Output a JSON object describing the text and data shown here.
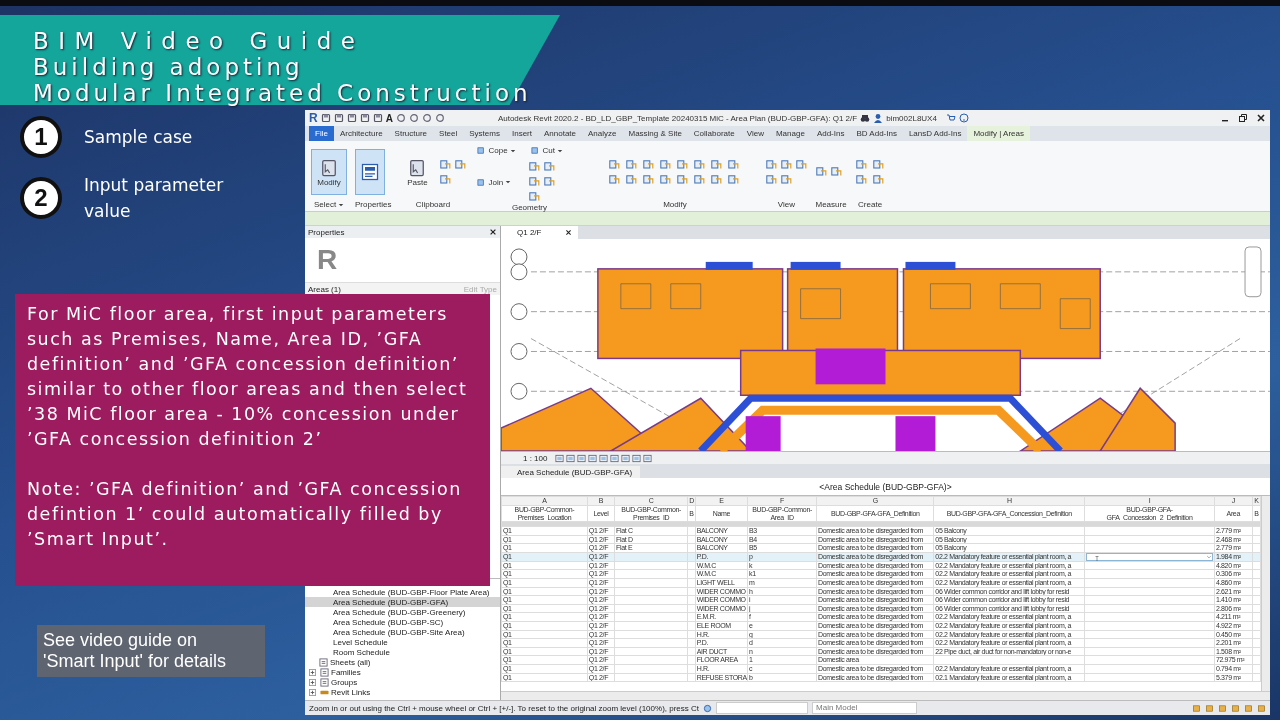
{
  "banner": {
    "lines": [
      "BIM Video Guide",
      "Building adopting",
      "Modular Integrated Construction"
    ]
  },
  "steps": [
    {
      "number": "1",
      "label": "Sample case"
    },
    {
      "number": "2",
      "label": "Input parameter value"
    }
  ],
  "note_box": {
    "paragraphs": [
      "For MiC floor area, first input parameters such as Premises, Name, Area ID, ’GFA definition’ and ’GFA concession definition’ similar to other floor areas and then select ’38 MiC floor area - 10% concession under ’GFA concession definition 2’",
      "Note: ’GFA definition’ and ’GFA concession defintion 1’ could automatically filled by ’Smart Input’."
    ]
  },
  "hint_box": {
    "text": "See video guide on 'Smart Input' for details"
  },
  "revit": {
    "app_logo": "R",
    "quick_access_glyph": "A",
    "title": "Autodesk Revit 2020.2 - BD_LD_GBP_Template 20240315 MiC - Area Plan (BUD-GBP-GFA): Q1 2/F",
    "user": "bim002L8UX4",
    "tabs": [
      {
        "label": "File",
        "kind": "file",
        "selected": false
      },
      {
        "label": "Architecture",
        "kind": "tab",
        "selected": false
      },
      {
        "label": "Structure",
        "kind": "tab",
        "selected": false
      },
      {
        "label": "Steel",
        "kind": "tab",
        "selected": false
      },
      {
        "label": "Systems",
        "kind": "tab",
        "selected": false
      },
      {
        "label": "Insert",
        "kind": "tab",
        "selected": false
      },
      {
        "label": "Annotate",
        "kind": "tab",
        "selected": false
      },
      {
        "label": "Analyze",
        "kind": "tab",
        "selected": false
      },
      {
        "label": "Massing & Site",
        "kind": "tab",
        "selected": false
      },
      {
        "label": "Collaborate",
        "kind": "tab",
        "selected": false
      },
      {
        "label": "View",
        "kind": "tab",
        "selected": false
      },
      {
        "label": "Manage",
        "kind": "tab",
        "selected": false
      },
      {
        "label": "Add-Ins",
        "kind": "tab",
        "selected": false
      },
      {
        "label": "BD Add-Ins",
        "kind": "tab",
        "selected": false
      },
      {
        "label": "LansD Add-Ins",
        "kind": "tab",
        "selected": false
      },
      {
        "label": "Modify | Areas",
        "kind": "tab",
        "selected": true
      }
    ],
    "ribbon_groups": [
      {
        "label": "Select",
        "menu": true,
        "tools": [
          {
            "kind": "large",
            "label": "Modify",
            "selected": true
          }
        ]
      },
      {
        "label": "Properties",
        "menu": false
      },
      {
        "label": "Clipboard",
        "menu": false,
        "tools": [
          {
            "kind": "large",
            "label": "Paste",
            "selected": false
          }
        ]
      },
      {
        "label": "Geometry",
        "menu": false,
        "tools": [
          {
            "kind": "small",
            "label": "Cope",
            "selected": false
          },
          {
            "kind": "small",
            "label": "Cut",
            "selected": false
          },
          {
            "kind": "small",
            "label": "Join",
            "selected": false
          }
        ]
      },
      {
        "label": "Modify",
        "menu": false
      },
      {
        "label": "View",
        "menu": false
      },
      {
        "label": "Measure",
        "menu": false
      },
      {
        "label": "Create",
        "menu": false
      }
    ],
    "properties": {
      "title": "Properties",
      "type_logo": "R",
      "category": "Areas (1)",
      "edit_type": "Edit Type"
    },
    "browser": {
      "items": [
        {
          "label": "Area Schedule (BUD-GBP-Floor Plate Area)",
          "kind": "view",
          "selected": false
        },
        {
          "label": "Area Schedule (BUD-GBP-GFA)",
          "kind": "view",
          "selected": true
        },
        {
          "label": "Area Schedule (BUD-GBP-Greenery)",
          "kind": "view",
          "selected": false
        },
        {
          "label": "Area Schedule (BUD-GBP-SC)",
          "kind": "view",
          "selected": false
        },
        {
          "label": "Area Schedule (BUD-GBP-Site Area)",
          "kind": "view",
          "selected": false
        },
        {
          "label": "Level Schedule",
          "kind": "view",
          "selected": false
        },
        {
          "label": "Room Schedule",
          "kind": "view",
          "selected": false
        },
        {
          "label": "Sheets (all)",
          "kind": "folder",
          "selected": false
        },
        {
          "label": "Families",
          "kind": "collapsed",
          "selected": false
        },
        {
          "label": "Groups",
          "kind": "collapsed",
          "selected": false
        },
        {
          "label": "Revit Links",
          "kind": "links",
          "selected": false
        }
      ]
    },
    "plan_view": {
      "tab": "Q1 2/F",
      "scale": "1 : 100"
    },
    "schedule": {
      "tab": "Area Schedule (BUD-GBP-GFA)",
      "title": "<Area Schedule (BUD-GBP-GFA)>",
      "letters": [
        "A",
        "B",
        "C",
        "D",
        "E",
        "F",
        "G",
        "H",
        "I",
        "J",
        "K"
      ],
      "headers": [
        "BUD-GBP-Common-Premises_Location",
        "Level",
        "BUD-GBP-Common-Premises_ID",
        "B",
        "Name",
        "BUD-GBP-Common-Area_ID",
        "BUD-GBP-GFA-GFA_Definition",
        "BUD-GBP-GFA-GFA_Concession_Definition",
        "BUD-GBP-GFA-GFA_Concession_2_Definition",
        "Area",
        "B"
      ],
      "rows": [
        {
          "location": "Q1",
          "level": "Q1 2/F",
          "premises_id": "Flat C",
          "name": "BALCONY",
          "area_id": "B3",
          "gfa_definition": "Domestic area to be disregarded from",
          "concession": "05 Balcony",
          "area": "2.779 m²",
          "selected": false,
          "editing": false
        },
        {
          "location": "Q1",
          "level": "Q1 2/F",
          "premises_id": "Flat D",
          "name": "BALCONY",
          "area_id": "B4",
          "gfa_definition": "Domestic area to be disregarded from",
          "concession": "05 Balcony",
          "area": "2.468 m²",
          "selected": false,
          "editing": false
        },
        {
          "location": "Q1",
          "level": "Q1 2/F",
          "premises_id": "Flat E",
          "name": "BALCONY",
          "area_id": "B5",
          "gfa_definition": "Domestic area to be disregarded from",
          "concession": "05 Balcony",
          "area": "2.779 m²",
          "selected": false,
          "editing": false
        },
        {
          "location": "Q1",
          "level": "Q1 2/F",
          "name": "P.D.",
          "area_id": "p",
          "gfa_definition": "Domestic area to be disregarded from",
          "concession": "02.2 Mandatory feature or essential plant room, a",
          "area": "1.984 m²",
          "selected": true,
          "editing": true
        },
        {
          "location": "Q1",
          "level": "Q1 2/F",
          "name": "W.M.C",
          "area_id": "k",
          "gfa_definition": "Domestic area to be disregarded from",
          "concession": "02.2 Mandatory feature or essential plant room, a",
          "area": "4.820 m²",
          "selected": false,
          "editing": false
        },
        {
          "location": "Q1",
          "level": "Q1 2/F",
          "name": "W.M.C",
          "area_id": "k1",
          "gfa_definition": "Domestic area to be disregarded from",
          "concession": "02.2 Mandatory feature or essential plant room, a",
          "area": "0.306 m²",
          "selected": false,
          "editing": false
        },
        {
          "location": "Q1",
          "level": "Q1 2/F",
          "name": "LIGHT WELL",
          "area_id": "m",
          "gfa_definition": "Domestic area to be disregarded from",
          "concession": "02.2 Mandatory feature or essential plant room, a",
          "area": "4.860 m²",
          "selected": false,
          "editing": false
        },
        {
          "location": "Q1",
          "level": "Q1 2/F",
          "name": "WIDER COMMO",
          "area_id": "h",
          "gfa_definition": "Domestic area to be disregarded from",
          "concession": "06 Wider common corridor and lift lobby for resid",
          "area": "2.621 m²",
          "selected": false,
          "editing": false
        },
        {
          "location": "Q1",
          "level": "Q1 2/F",
          "name": "WIDER COMMO",
          "area_id": "i",
          "gfa_definition": "Domestic area to be disregarded from",
          "concession": "06 Wider common corridor and lift lobby for resid",
          "area": "1.410 m²",
          "selected": false,
          "editing": false
        },
        {
          "location": "Q1",
          "level": "Q1 2/F",
          "name": "WIDER COMMO",
          "area_id": "j",
          "gfa_definition": "Domestic area to be disregarded from",
          "concession": "06 Wider common corridor and lift lobby for resid",
          "area": "2.806 m²",
          "selected": false,
          "editing": false
        },
        {
          "location": "Q1",
          "level": "Q1 2/F",
          "name": "E.M.R.",
          "area_id": "f",
          "gfa_definition": "Domestic area to be disregarded from",
          "concession": "02.2 Mandatory feature or essential plant room, a",
          "area": "4.211 m²",
          "selected": false,
          "editing": false
        },
        {
          "location": "Q1",
          "level": "Q1 2/F",
          "name": "ELE ROOM",
          "area_id": "e",
          "gfa_definition": "Domestic area to be disregarded from",
          "concession": "02.2 Mandatory feature or essential plant room, a",
          "area": "4.922 m²",
          "selected": false,
          "editing": false
        },
        {
          "location": "Q1",
          "level": "Q1 2/F",
          "name": "H.R.",
          "area_id": "g",
          "gfa_definition": "Domestic area to be disregarded from",
          "concession": "02.2 Mandatory feature or essential plant room, a",
          "area": "0.450 m²",
          "selected": false,
          "editing": false
        },
        {
          "location": "Q1",
          "level": "Q1 2/F",
          "name": "P.D.",
          "area_id": "d",
          "gfa_definition": "Domestic area to be disregarded from",
          "concession": "02.2 Mandatory feature or essential plant room, a",
          "area": "2.201 m²",
          "selected": false,
          "editing": false
        },
        {
          "location": "Q1",
          "level": "Q1 2/F",
          "name": "AIR DUCT",
          "area_id": "n",
          "gfa_definition": "Domestic area to be disregarded from",
          "concession": "22 Pipe duct, air duct for non-mandatory or non-e",
          "area": "1.508 m²",
          "selected": false,
          "editing": false
        },
        {
          "location": "Q1",
          "level": "Q1 2/F",
          "name": "FLOOR AREA",
          "area_id": "1",
          "gfa_definition": "Domestic area",
          "area": "72.975 m²",
          "selected": false,
          "editing": false
        },
        {
          "location": "Q1",
          "level": "Q1 2/F",
          "name": "H.R.",
          "area_id": "c",
          "gfa_definition": "Domestic area to be disregarded from",
          "concession": "02.2 Mandatory feature or essential plant room, a",
          "area": "0.794 m²",
          "selected": false,
          "editing": false
        },
        {
          "location": "Q1",
          "level": "Q1 2/F",
          "name": "REFUSE STORA",
          "area_id": "b",
          "gfa_definition": "Domestic area to be disregarded from",
          "concession": "02.1 Mandatory feature or essential plant room, a",
          "area": "5.379 m²",
          "selected": false,
          "editing": false
        }
      ]
    },
    "status": {
      "message": "Zoom in or out using the Ctrl + mouse wheel or Ctrl + [+/-]. To reset to the original zoom level (100%), press Ct",
      "workset": "Main Model"
    }
  }
}
